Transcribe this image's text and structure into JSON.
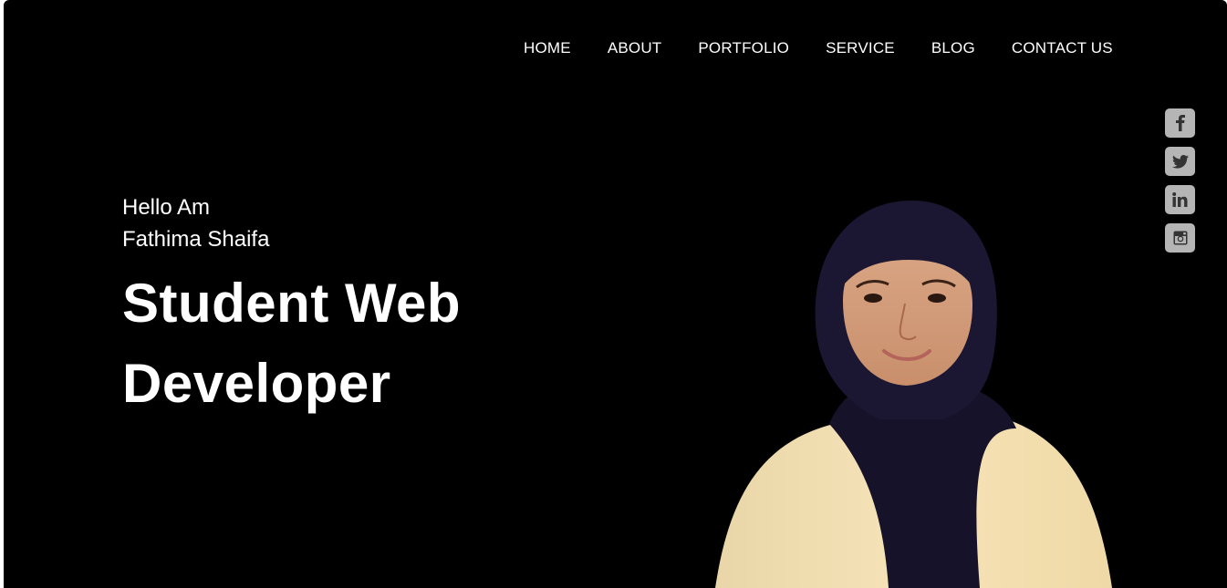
{
  "nav": {
    "items": [
      {
        "label": "HOME"
      },
      {
        "label": "ABOUT"
      },
      {
        "label": "PORTFOLIO"
      },
      {
        "label": "SERVICE"
      },
      {
        "label": "BLOG"
      },
      {
        "label": "CONTACT US"
      }
    ]
  },
  "hero": {
    "greeting_line1": "Hello Am",
    "greeting_line2": "Fathima Shaifa",
    "title_line1": "Student Web",
    "title_line2": "Developer"
  },
  "social": {
    "icons": [
      "facebook-icon",
      "twitter-icon",
      "linkedin-icon",
      "instagram-icon"
    ]
  },
  "colors": {
    "background": "#000000",
    "text": "#ffffff",
    "social_bg": "#b5b5b5",
    "social_icon": "#333333"
  }
}
